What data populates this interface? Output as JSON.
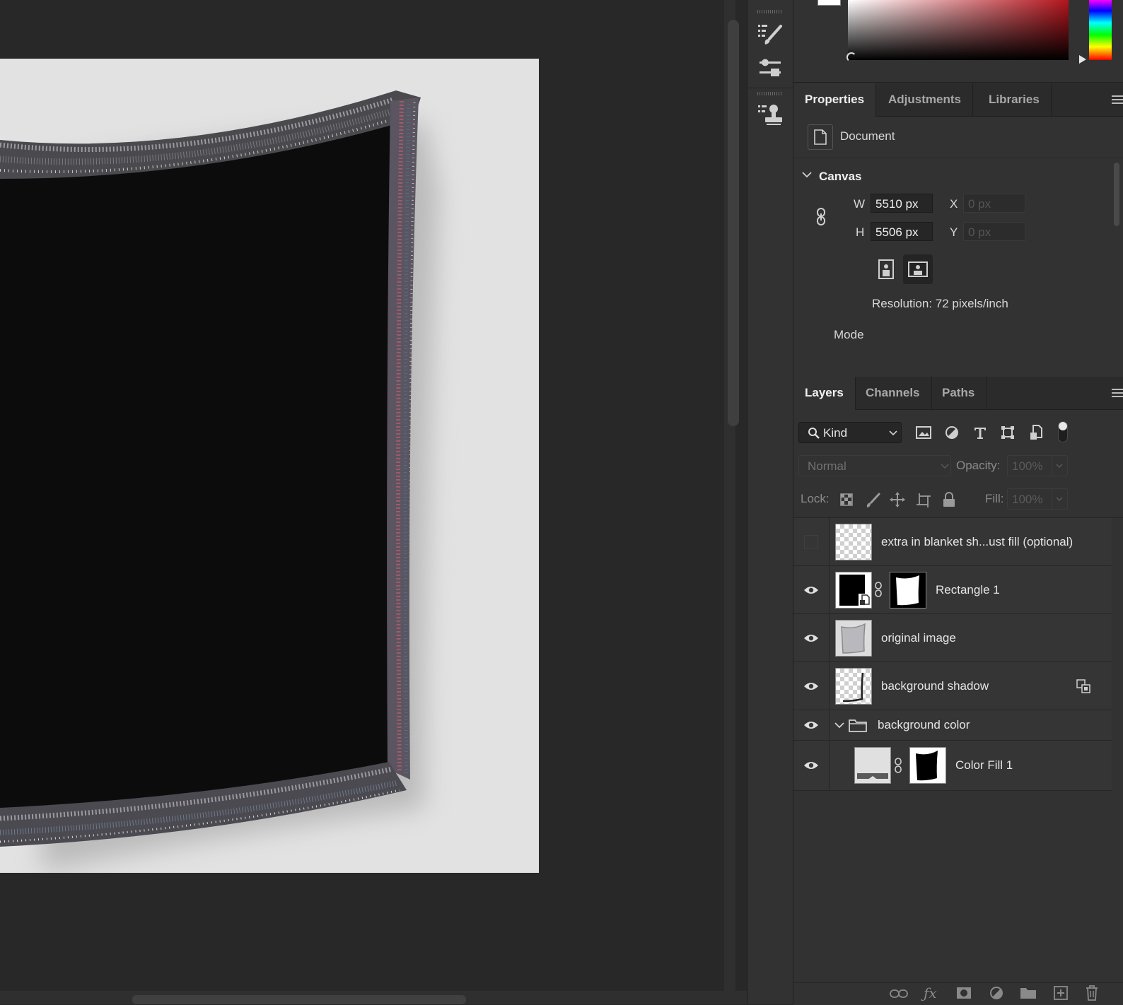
{
  "properties_tabs": [
    "Properties",
    "Adjustments",
    "Libraries"
  ],
  "document_label": "Document",
  "canvas": {
    "section_title": "Canvas",
    "w_label": "W",
    "w_value": "5510 px",
    "h_label": "H",
    "h_value": "5506 px",
    "x_label": "X",
    "x_value": "0 px",
    "y_label": "Y",
    "y_value": "0 px",
    "resolution": "Resolution: 72 pixels/inch",
    "mode_label": "Mode"
  },
  "layers_tabs": [
    "Layers",
    "Channels",
    "Paths"
  ],
  "layers_filter": {
    "kind_label": "Kind"
  },
  "blend": {
    "mode": "Normal",
    "opacity_label": "Opacity:",
    "opacity_value": "100%",
    "lock_label": "Lock:",
    "fill_label": "Fill:",
    "fill_value": "100%"
  },
  "layers": [
    {
      "name": "extra in blanket sh...ust fill (optional)",
      "visible": false
    },
    {
      "name": "Rectangle 1",
      "visible": true
    },
    {
      "name": "original image",
      "visible": true
    },
    {
      "name": "background shadow",
      "visible": true
    },
    {
      "name": "background color",
      "visible": true,
      "type": "group"
    },
    {
      "name": "Color Fill 1",
      "visible": true
    }
  ],
  "colors": {
    "canvas_bg": "#282828",
    "panel_bg": "#323232",
    "document_bg": "#e2e2e2",
    "blanket": "#0c0c0c",
    "fringe": "#5a5560"
  },
  "icons": [
    "brush-settings-icon",
    "adjust-sliders-icon",
    "clone-source-icon",
    "document-icon",
    "link-icon",
    "portrait-icon",
    "landscape-icon",
    "search-icon",
    "eye-icon",
    "folder-icon",
    "smart-object-icon"
  ]
}
